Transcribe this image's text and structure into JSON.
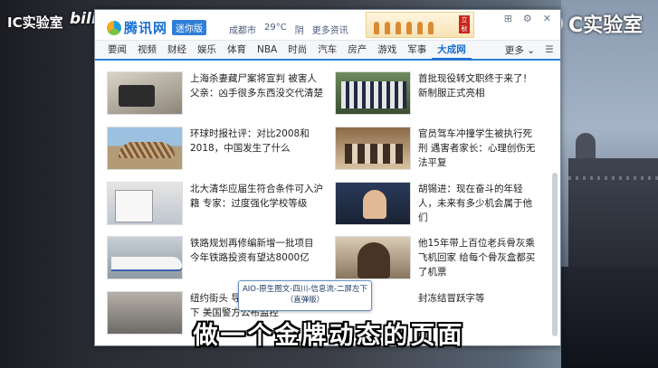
{
  "watermark": {
    "left": "IC实验室",
    "bili": "bili",
    "right": "C实验室"
  },
  "window": {
    "logo": "腾讯网",
    "mini_badge": "迷你版",
    "city": "成都市",
    "temperature": "29°C",
    "weather": "阴",
    "more_weather": "更多资讯",
    "banner_seal": "立秋",
    "controls": {
      "pin": "⊞",
      "settings": "⚙",
      "close": "✕"
    }
  },
  "nav": {
    "items": [
      "要闻",
      "视频",
      "财经",
      "娱乐",
      "体育",
      "NBA",
      "时尚",
      "汽车",
      "房产",
      "游戏",
      "军事",
      "大成网"
    ],
    "active_index": 11,
    "more": "更多",
    "menu": "☰"
  },
  "news_left": [
    "上海杀妻藏尸案将宣判 被害人父亲：凶手很多东西没交代清楚",
    "环球时报社评：对比2008和2018，中国发生了什么",
    "北大清华应届生符合条件可入沪籍 专家：过度强化学校等级",
    "铁路规划再修编新增一批项目 今年铁路投资有望达8000亿",
    "纽约街头 导华的涂鸦嫌犯被拍下 美国警方公布监控"
  ],
  "news_right": [
    "首批现役转文职终于来了！新制服正式亮相",
    "官员驾车冲撞学生被执行死刑 遇害者家长：心理创伤无法平复",
    "胡锡进：现在奋斗的年轻人，未来有多少机会属于他们",
    "他15年带上百位老兵骨灰乘飞机回家 给每个骨灰盒都买了机票",
    "封冻结冒跃字等"
  ],
  "tooltip": {
    "line1": "AIO-原生图文-四川-信息流-二屏左下",
    "line2": "（直弹版）"
  },
  "subtitle": "做一个金牌动态的页面"
}
